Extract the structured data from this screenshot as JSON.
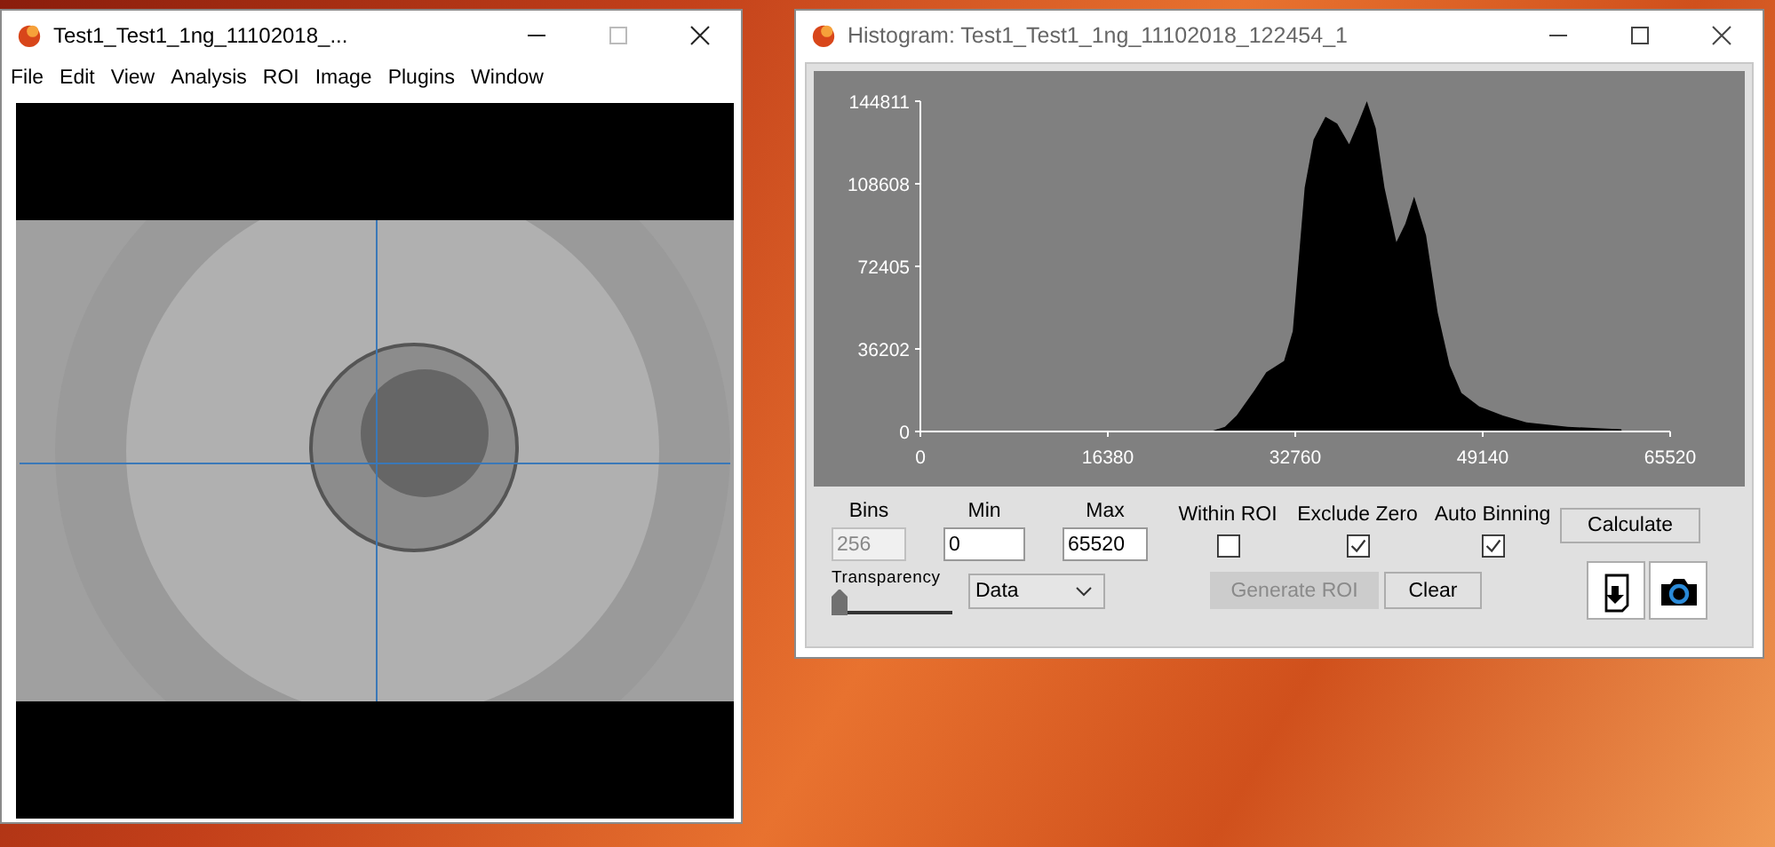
{
  "image_window": {
    "title": "Test1_Test1_1ng_11102018_...",
    "menu": [
      "File",
      "Edit",
      "View",
      "Analysis",
      "ROI",
      "Image",
      "Plugins",
      "Window"
    ]
  },
  "histogram_window": {
    "title": "Histogram: Test1_Test1_1ng_11102018_122454_1",
    "chart_data": {
      "type": "area",
      "xlim": [
        0,
        65520
      ],
      "ylim": [
        0,
        144811
      ],
      "xticks": [
        0,
        16380,
        32760,
        49140,
        65520
      ],
      "yticks": [
        0,
        36202,
        72405,
        108608,
        144811
      ],
      "x": [
        25320,
        26610,
        27640,
        29190,
        30230,
        31780,
        32550,
        33070,
        33590,
        34360,
        35400,
        36430,
        37460,
        38240,
        39010,
        39790,
        40560,
        41600,
        42370,
        43150,
        44180,
        45210,
        46250,
        47280,
        48830,
        50890,
        52960,
        56580,
        61230,
        61330
      ],
      "series": [
        {
          "color": "#000000",
          "values": [
            0,
            2000,
            7000,
            18000,
            26000,
            31000,
            44000,
            76000,
            107000,
            128000,
            138000,
            135000,
            126000,
            135000,
            144811,
            133000,
            107000,
            83000,
            91000,
            103000,
            86000,
            52000,
            29000,
            17000,
            11000,
            7000,
            4000,
            2000,
            1000,
            0
          ]
        }
      ]
    },
    "fields": [
      {
        "label": "Bins",
        "value": "256",
        "disabled": true
      },
      {
        "label": "Min",
        "value": "0",
        "disabled": false
      },
      {
        "label": "Max",
        "value": "65520",
        "disabled": false
      }
    ],
    "checkboxes": [
      {
        "label": "Within ROI",
        "checked": false
      },
      {
        "label": "Exclude Zero",
        "checked": true
      },
      {
        "label": "Auto Binning",
        "checked": true
      }
    ],
    "calculate_button": "Calculate",
    "transparency": {
      "label": "Transparency",
      "level": 0.0
    },
    "dropdown": {
      "value": "Data"
    },
    "buttons": [
      {
        "label": "Generate ROI",
        "disabled": true
      },
      {
        "label": "Clear",
        "disabled": false
      }
    ]
  }
}
